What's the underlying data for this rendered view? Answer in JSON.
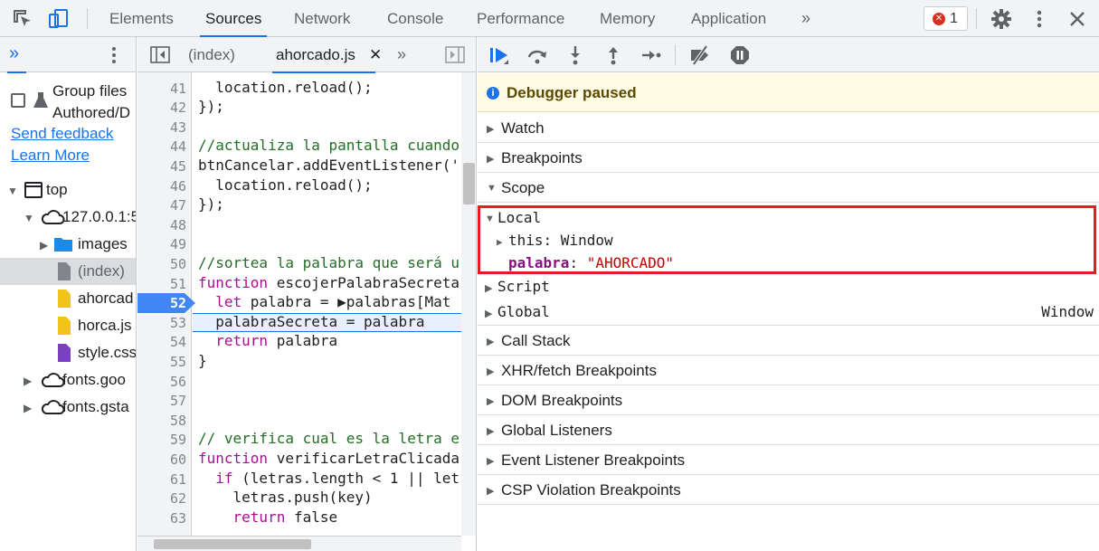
{
  "toolbar": {
    "tabs": [
      "Elements",
      "Sources",
      "Network",
      "Console",
      "Performance",
      "Memory",
      "Application"
    ],
    "active_tab": "Sources",
    "more_tabs": "»",
    "error_count": "1",
    "error_glyph": "✕"
  },
  "navigator": {
    "more": "»",
    "group_files_line1": "Group files",
    "group_files_line2": "Authored/D",
    "send_feedback": "Send feedback",
    "learn_more": "Learn More",
    "tree": [
      {
        "label": "top",
        "indent": 0,
        "tri": "▼",
        "icon": "frame"
      },
      {
        "label": "127.0.0.1:5",
        "indent": 1,
        "tri": "▼",
        "icon": "cloud"
      },
      {
        "label": "images",
        "indent": 2,
        "tri": "▶",
        "icon": "folder"
      },
      {
        "label": "(index)",
        "indent": 2,
        "tri": "",
        "icon": "doc-gray",
        "selected": true
      },
      {
        "label": "ahorcad",
        "indent": 2,
        "tri": "",
        "icon": "doc-yellow"
      },
      {
        "label": "horca.js",
        "indent": 2,
        "tri": "",
        "icon": "doc-yellow"
      },
      {
        "label": "style.css",
        "indent": 2,
        "tri": "",
        "icon": "doc-purple"
      },
      {
        "label": "fonts.goo",
        "indent": 1,
        "tri": "▶",
        "icon": "cloud"
      },
      {
        "label": "fonts.gsta",
        "indent": 1,
        "tri": "▶",
        "icon": "cloud"
      }
    ]
  },
  "editor": {
    "tabs": [
      "(index)",
      "ahorcado.js"
    ],
    "active_tab": "ahorcado.js",
    "close": "✕",
    "more": "»",
    "lines": [
      {
        "n": "41",
        "code": "  location.reload();"
      },
      {
        "n": "42",
        "code": "});"
      },
      {
        "n": "43",
        "code": ""
      },
      {
        "n": "44",
        "code": "//actualiza la pantalla cuando",
        "cls": "cm"
      },
      {
        "n": "45",
        "code": "btnCancelar.addEventListener('"
      },
      {
        "n": "46",
        "code": "  location.reload();"
      },
      {
        "n": "47",
        "code": "});"
      },
      {
        "n": "48",
        "code": ""
      },
      {
        "n": "49",
        "code": ""
      },
      {
        "n": "50",
        "code": "//sortea la palabra que será u",
        "cls": "cm"
      },
      {
        "n": "51",
        "code": "function escojerPalabraSecreta",
        "kw": "function"
      },
      {
        "n": "52",
        "code": "  let palabra = ▶palabras[Mat",
        "kw": "let",
        "breakpoint": true
      },
      {
        "n": "53",
        "code": "  palabraSecreta = palabra",
        "exec": true
      },
      {
        "n": "54",
        "code": "  return palabra",
        "kw": "return"
      },
      {
        "n": "55",
        "code": "}"
      },
      {
        "n": "56",
        "code": ""
      },
      {
        "n": "57",
        "code": ""
      },
      {
        "n": "58",
        "code": ""
      },
      {
        "n": "59",
        "code": "// verifica cual es la letra e",
        "cls": "cm"
      },
      {
        "n": "60",
        "code": "function verificarLetraClicada",
        "kw": "function"
      },
      {
        "n": "61",
        "code": "  if (letras.length < 1 || let",
        "kw": "if"
      },
      {
        "n": "62",
        "code": "    letras.push(key)"
      },
      {
        "n": "63",
        "code": "    return false",
        "kw": "return"
      }
    ]
  },
  "debugger": {
    "paused": "Debugger paused",
    "sections_top": [
      "Watch",
      "Breakpoints",
      "Scope"
    ],
    "scope": {
      "local": "Local",
      "this_key": "this",
      "this_val": "Window",
      "var_key": "palabra",
      "var_val": "\"AHORCADO\"",
      "script": "Script",
      "global": "Global",
      "global_val": "Window"
    },
    "sections_bottom": [
      "Call Stack",
      "XHR/fetch Breakpoints",
      "DOM Breakpoints",
      "Global Listeners",
      "Event Listener Breakpoints",
      "CSP Violation Breakpoints"
    ]
  },
  "colors": {
    "accent": "#1a73e8",
    "highlight": "#e41b23",
    "paused_bg": "#fffbe5"
  }
}
